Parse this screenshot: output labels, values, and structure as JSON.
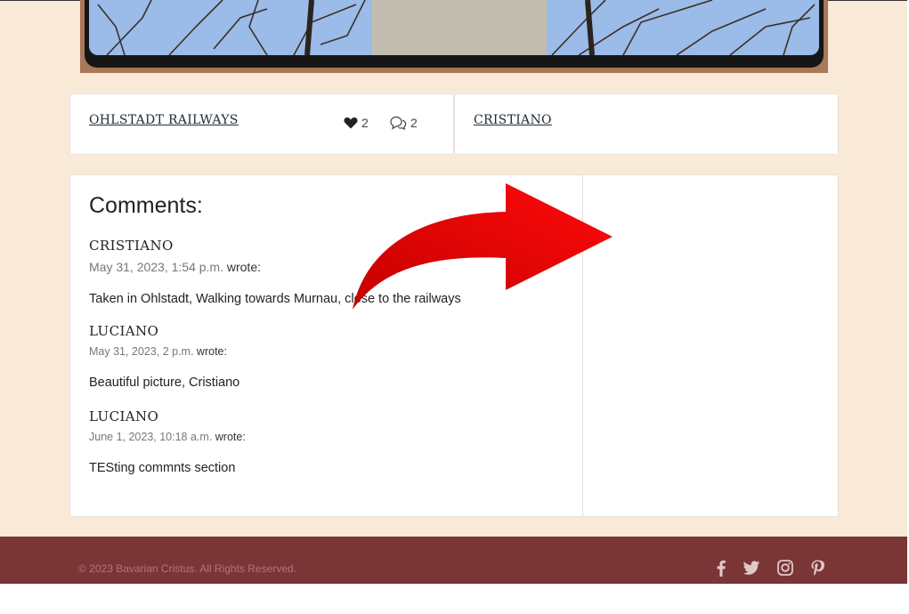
{
  "post": {
    "title": "OHLSTADT RAILWAYS",
    "likes": "2",
    "comment_count": "2",
    "author": "CRISTIANO"
  },
  "comments_section": {
    "heading": "Comments:",
    "wrote_label": "wrote:",
    "items": [
      {
        "author": "CRISTIANO",
        "date": "May 31, 2023, 1:54 p.m.",
        "body": "Taken in Ohlstadt, Walking towards Murnau, close to the railways"
      },
      {
        "author": "LUCIANO",
        "date": "May 31, 2023, 2 p.m.",
        "body": "Beautiful picture, Cristiano"
      },
      {
        "author": "LUCIANO",
        "date": "June 1, 2023, 10:18 a.m.",
        "body": "TESting commnts section"
      }
    ]
  },
  "footer": {
    "copyright": "© 2023 Bavarian Cristus. All Rights Reserved.",
    "social_icons": [
      "facebook-icon",
      "twitter-icon",
      "instagram-icon",
      "pinterest-icon"
    ]
  },
  "colors": {
    "page_background": "#f9ead8",
    "footer": "#7a3536",
    "annotation_arrow": "#e00000"
  }
}
